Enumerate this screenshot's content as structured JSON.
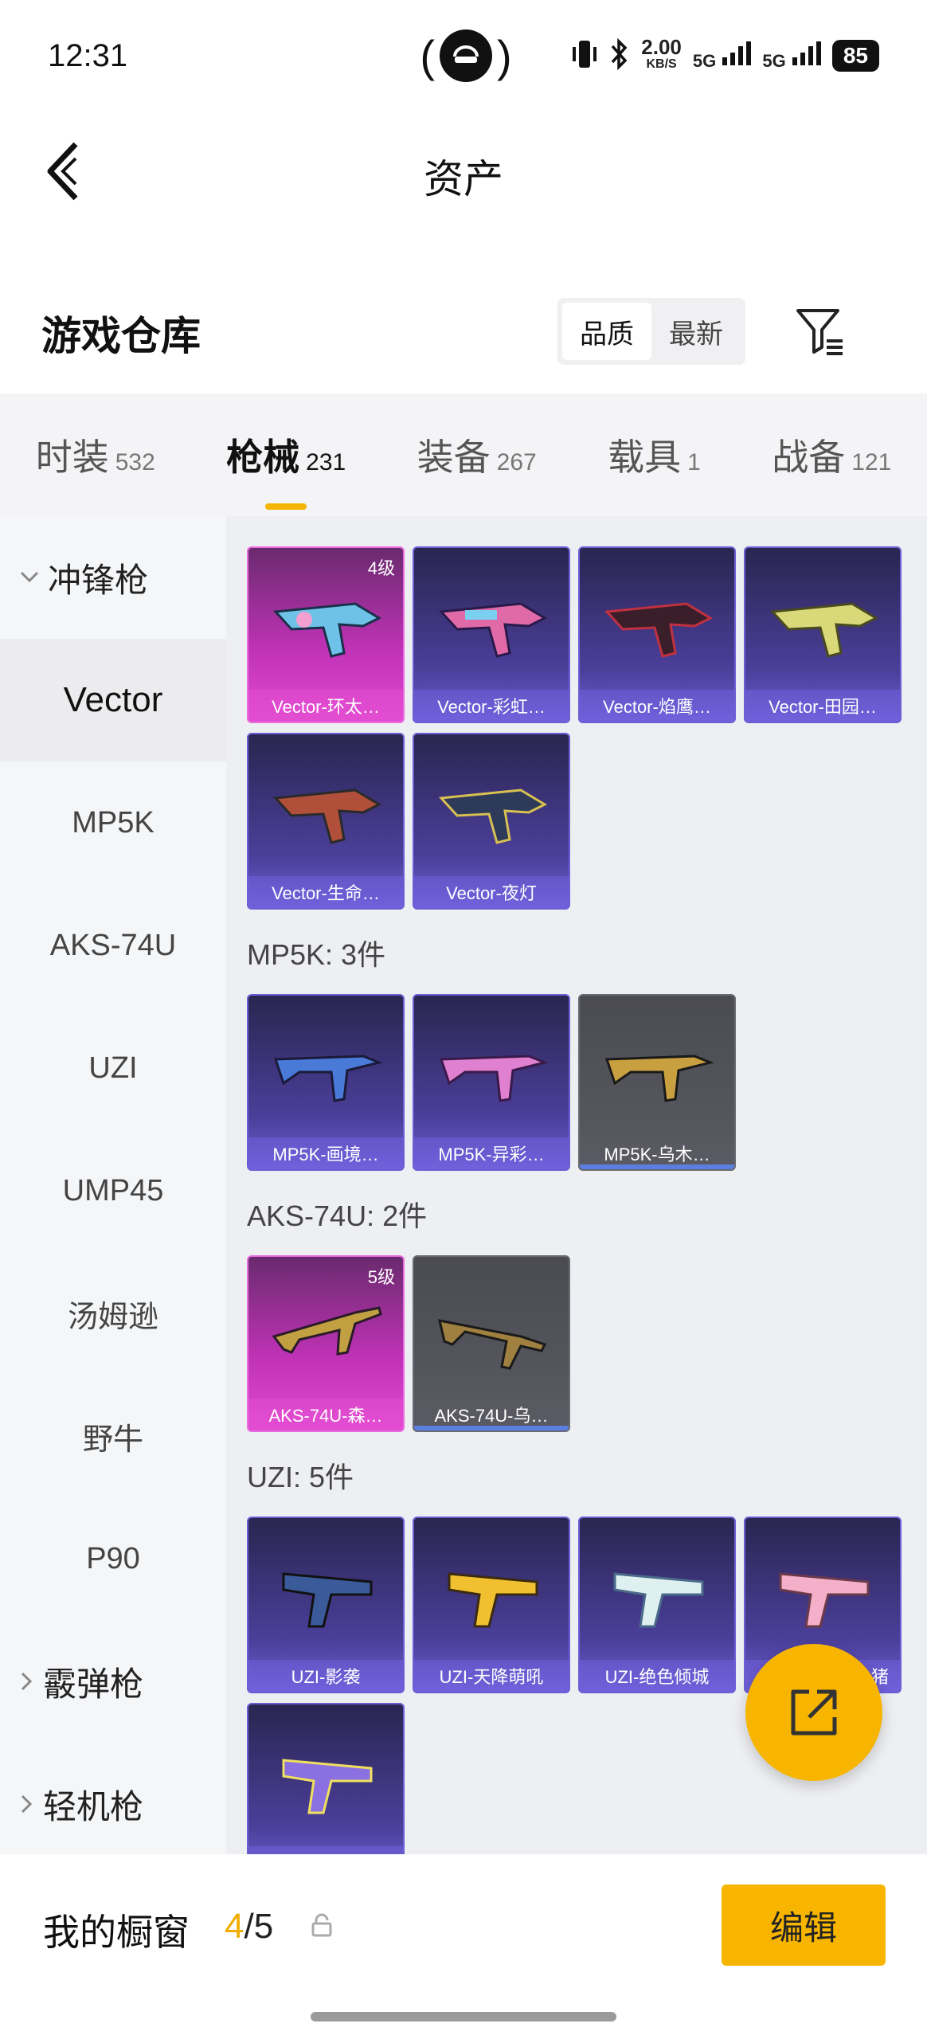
{
  "status_bar": {
    "time": "12:31",
    "net_speed": "2.00",
    "net_unit": "KB/S",
    "sig1": "5G",
    "sig2": "5G",
    "battery": "85"
  },
  "header": {
    "title": "资产"
  },
  "warehouse": {
    "title": "游戏仓库",
    "sort_options": [
      "品质",
      "最新"
    ],
    "sort_active": "品质"
  },
  "tabs": [
    {
      "label": "时装",
      "count": "532"
    },
    {
      "label": "枪械",
      "count": "231"
    },
    {
      "label": "装备",
      "count": "267"
    },
    {
      "label": "载具",
      "count": "1"
    },
    {
      "label": "战备",
      "count": "121"
    }
  ],
  "tab_active": "枪械",
  "sidebar": {
    "group_top": "冲锋枪",
    "items": [
      "Vector",
      "MP5K",
      "AKS-74U",
      "UZI",
      "UMP45",
      "汤姆逊",
      "野牛",
      "P90"
    ],
    "active_item": "Vector",
    "group_shotgun": "霰弹枪",
    "group_lmg": "轻机枪"
  },
  "sections": {
    "mp5k_heading": "MP5K: 3件",
    "aks_heading": "AKS-74U: 2件",
    "uzi_heading": "UZI: 5件"
  },
  "cards": {
    "vector": [
      {
        "label": "Vector-环太…",
        "level": "4级",
        "style": "pink"
      },
      {
        "label": "Vector-彩虹…",
        "style": "purple"
      },
      {
        "label": "Vector-焰鹰…",
        "style": "purple"
      },
      {
        "label": "Vector-田园…",
        "style": "purple"
      },
      {
        "label": "Vector-生命…",
        "style": "purple"
      },
      {
        "label": "Vector-夜灯",
        "style": "purple"
      }
    ],
    "mp5k": [
      {
        "label": "MP5K-画境…",
        "style": "purple"
      },
      {
        "label": "MP5K-异彩…",
        "style": "purple"
      },
      {
        "label": "MP5K-乌木…",
        "style": "gray"
      }
    ],
    "aks": [
      {
        "label": "AKS-74U-森…",
        "level": "5级",
        "style": "pink"
      },
      {
        "label": "AKS-74U-乌…",
        "style": "gray"
      }
    ],
    "uzi": [
      {
        "label": "UZI-影袭",
        "style": "purple"
      },
      {
        "label": "UZI-天降萌吼",
        "style": "purple"
      },
      {
        "label": "UZI-绝色倾城",
        "style": "purple"
      },
      {
        "label": "猪",
        "style": "purple"
      },
      {
        "label": "",
        "style": "purple"
      }
    ]
  },
  "bottom": {
    "showcase_label": "我的橱窗",
    "showcase_current": "4",
    "showcase_total": "/5",
    "edit_label": "编辑"
  },
  "colors": {
    "accent": "#f7b500",
    "card_purple": "#4b3f9a",
    "card_pink": "#c233b8"
  }
}
